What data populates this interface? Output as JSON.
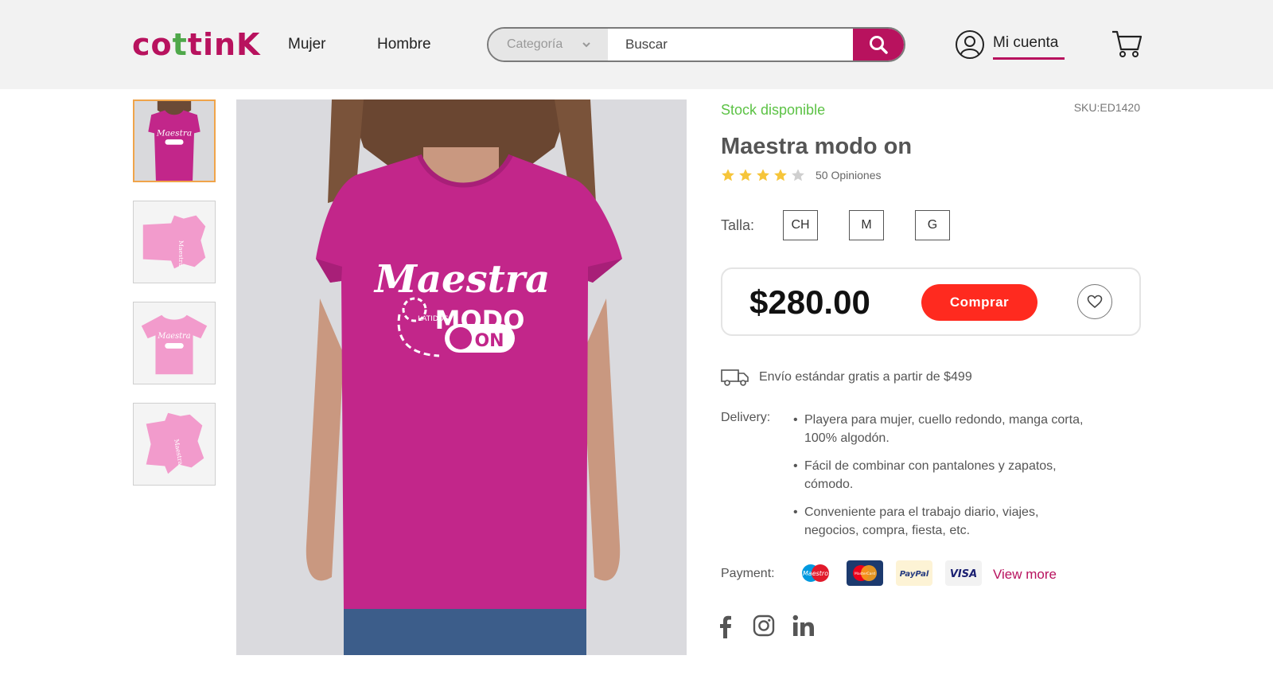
{
  "header": {
    "logo": {
      "part1": "co",
      "dot": "t",
      "part2": "tinK"
    },
    "nav": [
      {
        "label": "Mujer"
      },
      {
        "label": "Hombre"
      }
    ],
    "search": {
      "category": "Categoría",
      "placeholder": "Buscar"
    },
    "account_label": "Mi cuenta"
  },
  "colors": {
    "brand": "#b8125e",
    "stock_green": "#5cc245",
    "buy_red": "#ff2a1f",
    "shirt": "#c2268a",
    "star": "#f6c53a"
  },
  "gallery": {
    "thumbnails": [
      {
        "icon": "shirt-front-model-thumb",
        "active": true
      },
      {
        "icon": "shirt-folded-side-thumb"
      },
      {
        "icon": "shirt-flat-thumb"
      },
      {
        "icon": "shirt-folded-angle-thumb"
      }
    ],
    "shirt_print": {
      "line1": "Maestra",
      "line2": "MODO",
      "small": "LATIDOS",
      "toggle": "ON"
    }
  },
  "product": {
    "stock": "Stock disponible",
    "sku": "SKU:ED1420",
    "title": "Maestra modo on",
    "rating": 4,
    "rating_max": 5,
    "reviews": "50 Opiniones",
    "size_label": "Talla:",
    "sizes": [
      "CH",
      "M",
      "G"
    ],
    "price": "$280.00",
    "buy_label": "Comprar",
    "shipping": "Envío estándar gratis a partir de $499",
    "delivery_label": "Delivery:",
    "features": [
      "Playera para mujer, cuello redondo, manga corta, 100% algodón.",
      "Fácil de combinar con pantalones y zapatos, cómodo.",
      "Conveniente para el trabajo diario, viajes, negocios, compra, fiesta, etc."
    ],
    "payment_label": "Payment:",
    "payment_methods": [
      "Maestro",
      "MasterCard",
      "PayPal",
      "VISA"
    ],
    "view_more": "View more",
    "social": [
      "facebook-icon",
      "instagram-icon",
      "linkedin-icon"
    ]
  }
}
